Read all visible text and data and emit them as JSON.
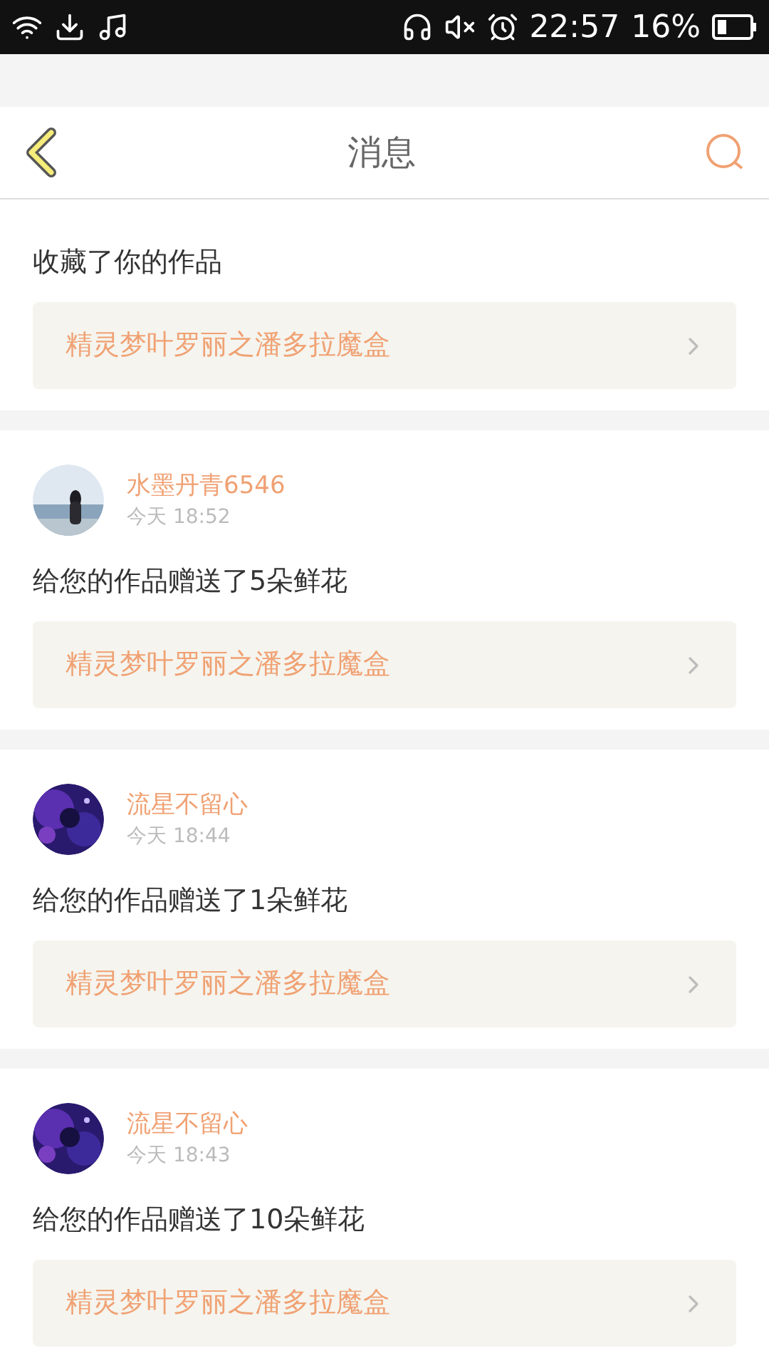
{
  "status_bar": {
    "time": "22:57",
    "battery": "16%"
  },
  "header": {
    "title": "消息"
  },
  "messages": [
    {
      "partial": true,
      "text": "收藏了你的作品",
      "work": "精灵梦叶罗丽之潘多拉魔盒"
    },
    {
      "partial": false,
      "user": "水墨丹青6546",
      "time": "今天 18:52",
      "text": "给您的作品赠送了5朵鲜花",
      "work": "精灵梦叶罗丽之潘多拉魔盒"
    },
    {
      "partial": false,
      "user": "流星不留心",
      "time": "今天 18:44",
      "text": "给您的作品赠送了1朵鲜花",
      "work": "精灵梦叶罗丽之潘多拉魔盒"
    },
    {
      "partial": false,
      "user": "流星不留心",
      "time": "今天 18:43",
      "text": "给您的作品赠送了10朵鲜花",
      "work": "精灵梦叶罗丽之潘多拉魔盒"
    }
  ]
}
